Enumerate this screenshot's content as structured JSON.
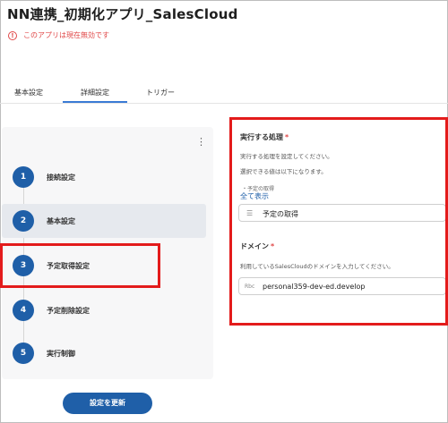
{
  "app": {
    "title": "NN連携_初期化アプリ_SalesCloud",
    "warning": "このアプリは現在無効です",
    "warning_icon": "!"
  },
  "tabs": [
    {
      "label": "基本設定"
    },
    {
      "label": "詳細設定",
      "active": true
    },
    {
      "label": "トリガー"
    }
  ],
  "steps": [
    {
      "number": "1",
      "label": "接続設定"
    },
    {
      "number": "2",
      "label": "基本設定"
    },
    {
      "number": "3",
      "label": "予定取得設定"
    },
    {
      "number": "4",
      "label": "予定削除設定"
    },
    {
      "number": "5",
      "label": "実行制御"
    }
  ],
  "update_button": "設定を更新",
  "process": {
    "title": "実行する処理",
    "required_mark": "*",
    "desc1": "実行する処理を設定してください。",
    "desc2": "選択できる値は以下になります。",
    "bullet": "・予定の取得",
    "show_all": "全て表示",
    "value": "予定の取得",
    "value_icon": "☰"
  },
  "domain": {
    "title": "ドメイン",
    "required_mark": "*",
    "desc": "利用しているSalesCloudのドメインを入力してください。",
    "value": "personal359-dev-ed.develop",
    "value_icon": "Rbc"
  },
  "colors": {
    "accent": "#1f5fa8",
    "highlight": "#e31b1b",
    "warning": "#e04848"
  }
}
